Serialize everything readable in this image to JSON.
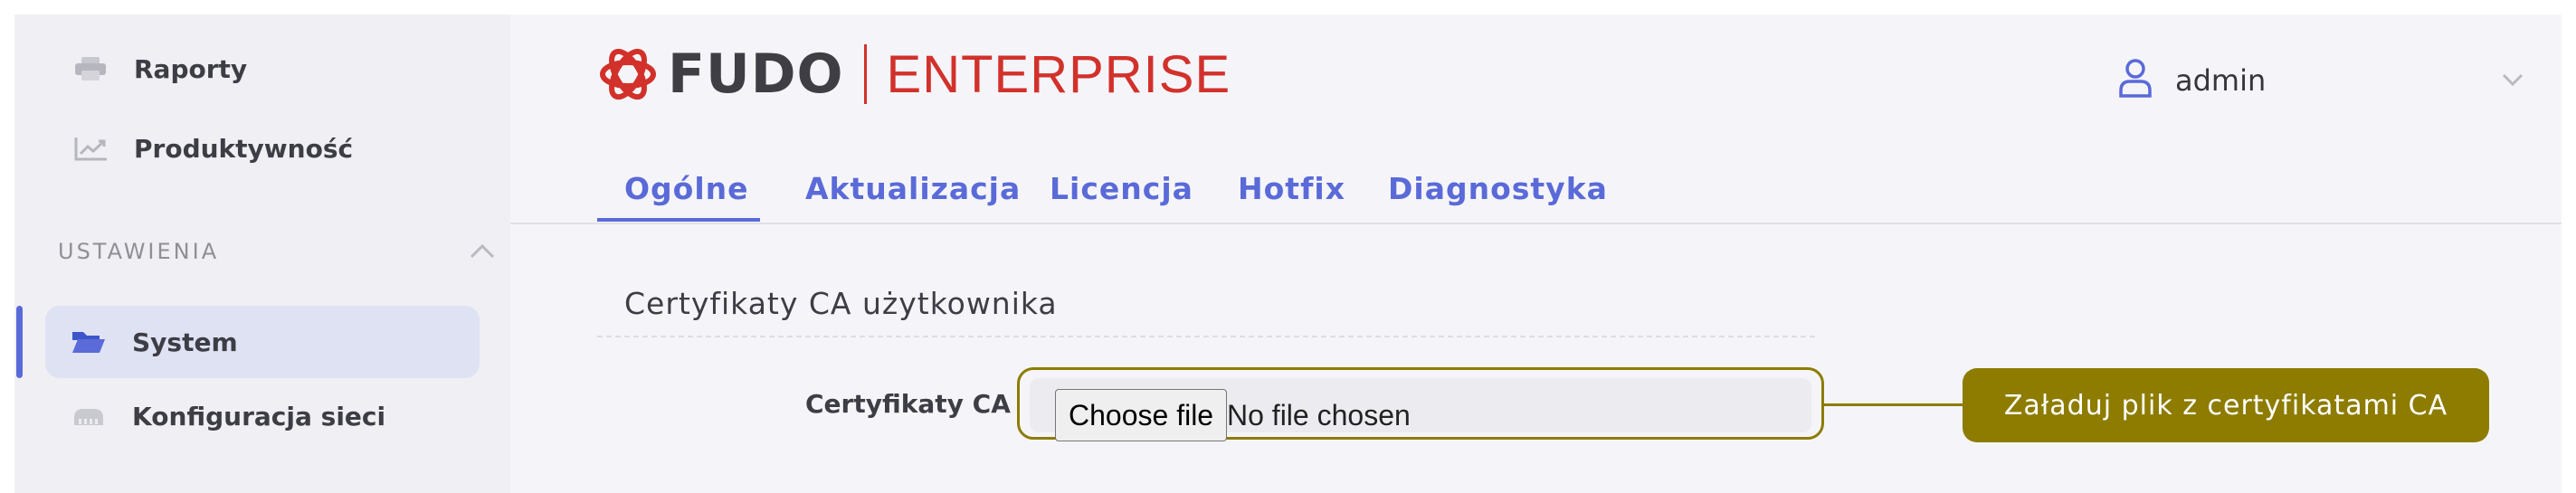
{
  "sidebar": {
    "items": [
      {
        "label": "Raporty",
        "icon": "printer-icon"
      },
      {
        "label": "Produktywność",
        "icon": "trend-chart-icon"
      }
    ],
    "section": {
      "label": "USTAWIENIA",
      "icon": "chevron-up-icon"
    },
    "settings_items": [
      {
        "label": "System",
        "icon": "folder-open-icon",
        "active": true
      },
      {
        "label": "Konfiguracja sieci",
        "icon": "network-switch-icon"
      }
    ]
  },
  "header": {
    "logo": {
      "brand": "FUDO",
      "edition": "ENTERPRISE",
      "icon": "fudo-logo-icon"
    },
    "user": {
      "name": "admin",
      "icon": "user-icon",
      "dropdown_icon": "chevron-down-icon"
    }
  },
  "tabs": [
    {
      "label": "Ogólne",
      "active": true
    },
    {
      "label": "Aktualizacja"
    },
    {
      "label": "Licencja"
    },
    {
      "label": "Hotfix"
    },
    {
      "label": "Diagnostyka"
    }
  ],
  "content": {
    "section_title": "Certyfikaty CA użytkownika",
    "field": {
      "label": "Certyfikaty CA",
      "file_button": "Choose file",
      "file_status": "No file chosen"
    },
    "callout": "Załaduj plik z certyfikatami CA"
  },
  "colors": {
    "accent": "#5a6ad8",
    "brand_red": "#d2312b",
    "callout": "#8d7c00"
  }
}
